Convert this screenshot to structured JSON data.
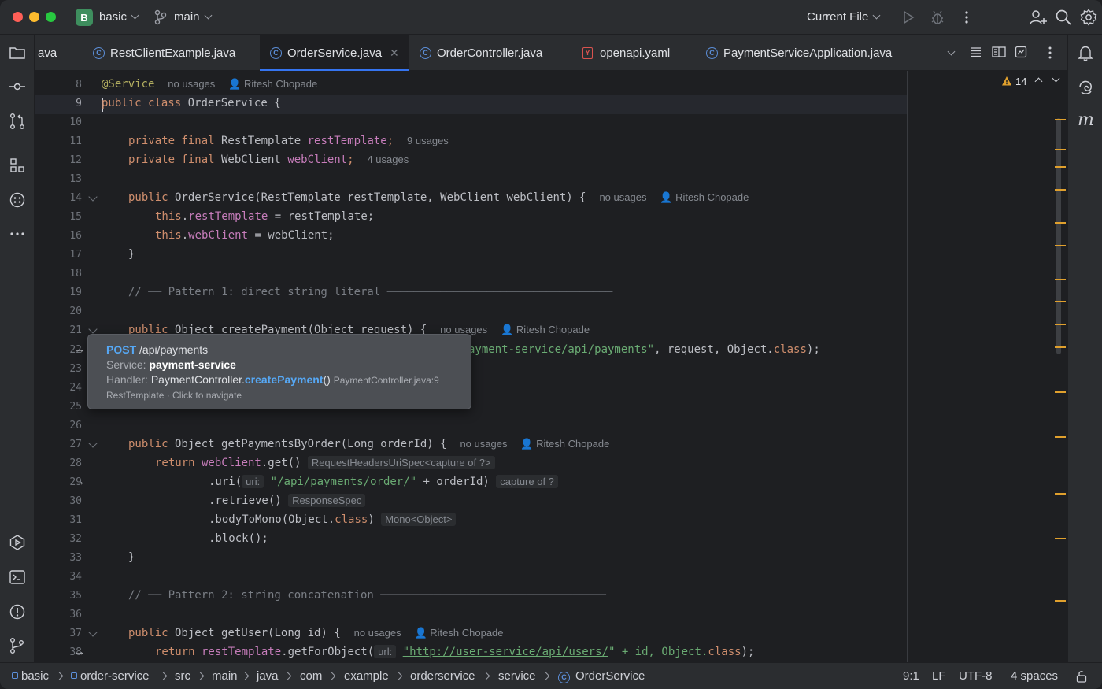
{
  "titlebar": {
    "project_badge": "B",
    "project_name": "basic",
    "branch": "main",
    "run_config": "Current File"
  },
  "tabs": [
    {
      "label": "ava",
      "icon": "none"
    },
    {
      "label": "RestClientExample.java",
      "icon": "class-icon"
    },
    {
      "label": "OrderService.java",
      "icon": "class-icon",
      "active": true
    },
    {
      "label": "OrderController.java",
      "icon": "class-icon"
    },
    {
      "label": "openapi.yaml",
      "icon": "yaml-icon"
    },
    {
      "label": "PaymentServiceApplication.java",
      "icon": "spring-class-icon"
    }
  ],
  "editor": {
    "warnings_count": "14",
    "lines": {
      "l8": {
        "num": "8",
        "ann": "@Service",
        "hint1": "no usages",
        "author": "Ritesh Chopade"
      },
      "l9": {
        "num": "9",
        "kw1": "public",
        "kw2": "class",
        "name": "OrderService",
        "rest": " {"
      },
      "l10": {
        "num": "10"
      },
      "l11": {
        "num": "11",
        "kw": "private final",
        "type": " RestTemplate ",
        "field": "restTemplate",
        "end": ";",
        "hint": "9 usages"
      },
      "l12": {
        "num": "12",
        "kw": "private final",
        "type": " WebClient ",
        "field": "webClient",
        "end": ";",
        "hint": "4 usages"
      },
      "l13": {
        "num": "13"
      },
      "l14": {
        "num": "14",
        "kw": "public",
        "name": " OrderService",
        "rest": "(RestTemplate restTemplate, WebClient webClient) {",
        "hint": "no usages",
        "author": "Ritesh Chopade"
      },
      "l15": {
        "num": "15",
        "this": "this",
        "dot": ".",
        "field": "restTemplate",
        "rest": " = restTemplate;"
      },
      "l16": {
        "num": "16",
        "this": "this",
        "dot": ".",
        "field": "webClient",
        "rest": " = webClient;"
      },
      "l17": {
        "num": "17",
        "text": "}"
      },
      "l18": {
        "num": "18"
      },
      "l19": {
        "num": "19",
        "comment": "// ── Pattern 1: direct string literal ──────────────────────────────────"
      },
      "l20": {
        "num": "20"
      },
      "l21": {
        "num": "21",
        "kw": "public",
        "rest": " Object ",
        "name": "createPayment",
        "args": "(Object request) {",
        "hint": "no usages",
        "author": "Ritesh Chopade"
      },
      "l22": {
        "num": "22",
        "str": "ayment-service/api/payments\"",
        "rest": ", request, Object.",
        "kw": "class",
        "end": ");"
      },
      "l23": {
        "num": "23"
      },
      "l24": {
        "num": "24"
      },
      "l25": {
        "num": "25"
      },
      "l26": {
        "num": "26"
      },
      "l27": {
        "num": "27",
        "kw": "public",
        "rest": " Object ",
        "name": "getPaymentsByOrder",
        "args": "(Long orderId) {",
        "hint": "no usages",
        "author": "Ritesh Chopade"
      },
      "l28": {
        "num": "28",
        "kw": "return",
        "field": " webClient",
        "rest": ".get()",
        "ihint": "RequestHeadersUriSpec<capture of ?>"
      },
      "l29": {
        "num": "29",
        "pre": ".uri(",
        "param": "uri:",
        "str": "\"/api/payments/order/\"",
        "rest": " + orderId)",
        "ihint": "capture of ?"
      },
      "l30": {
        "num": "30",
        "pre": ".retrieve()",
        "ihint": "ResponseSpec"
      },
      "l31": {
        "num": "31",
        "pre": ".bodyToMono(Object.",
        "kw": "class",
        "end": ")",
        "ihint": "Mono<Object>"
      },
      "l32": {
        "num": "32",
        "pre": ".block();"
      },
      "l33": {
        "num": "33",
        "text": "}"
      },
      "l34": {
        "num": "34"
      },
      "l35": {
        "num": "35",
        "comment": "// ── Pattern 2: string concatenation ──────────────────────────────────"
      },
      "l36": {
        "num": "36"
      },
      "l37": {
        "num": "37",
        "kw": "public",
        "rest": " Object ",
        "name": "getUser",
        "args": "(Long id) {",
        "hint": "no usages",
        "author": "Ritesh Chopade"
      },
      "l38": {
        "num": "38",
        "kw": "return",
        "field": " restTemplate",
        "rest": ".getForObject(",
        "param": "url:",
        "url": "\"http://user-service/api/users/",
        "after": "\" + id, Object.",
        "kw2": "class",
        "end": ");"
      }
    }
  },
  "popup": {
    "method": "POST",
    "path": " /api/payments",
    "service_label": "Service: ",
    "service_value": "payment-service",
    "handler_label": "Handler: ",
    "handler_class": "PaymentController.",
    "handler_method": "createPayment",
    "handler_parens": "()",
    "handler_file": "PaymentController.java:9",
    "footer": "RestTemplate · Click to navigate"
  },
  "statusbar": {
    "crumbs": [
      "basic",
      "order-service",
      "src",
      "main",
      "java",
      "com",
      "example",
      "orderservice",
      "service",
      "OrderService"
    ],
    "position": "9:1",
    "line_sep": "LF",
    "encoding": "UTF-8",
    "indent": "4 spaces"
  },
  "colors": {
    "accent": "#3574f0",
    "keyword": "#cf8e6d",
    "string": "#6aab73",
    "field": "#c77dbb",
    "annotation": "#b3ae60",
    "warning": "#e0a02d"
  }
}
